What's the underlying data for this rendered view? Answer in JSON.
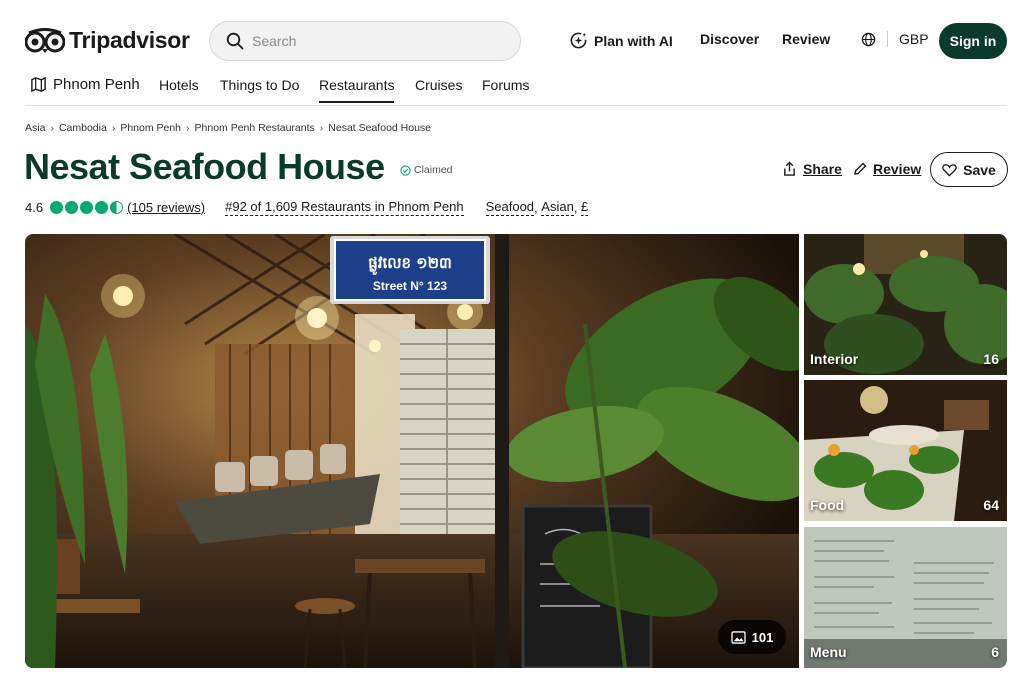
{
  "header": {
    "logo_text": "Tripadvisor",
    "search_placeholder": "Search",
    "plan_with_ai": "Plan with AI",
    "discover": "Discover",
    "review": "Review",
    "currency": "GBP",
    "sign_in": "Sign in"
  },
  "subnav": {
    "location": "Phnom Penh",
    "items": [
      "Hotels",
      "Things to Do",
      "Restaurants",
      "Cruises",
      "Forums"
    ],
    "active": "Restaurants"
  },
  "breadcrumb": [
    "Asia",
    "Cambodia",
    "Phnom Penh",
    "Phnom Penh Restaurants",
    "Nesat Seafood House"
  ],
  "restaurant": {
    "name": "Nesat Seafood House",
    "claimed": "Claimed",
    "rating": "4.6",
    "rating_value": 4.5,
    "reviews": "(105 reviews)",
    "rank": "#92 of 1,609 Restaurants in Phnom Penh",
    "cuisines": [
      "Seafood",
      "Asian",
      "£"
    ]
  },
  "actions": {
    "share": "Share",
    "review": "Review",
    "save": "Save"
  },
  "photos": {
    "total": "101",
    "street_sign_top": "ផ្លូវលេខ ១២៣",
    "street_sign_bottom": "Street N° 123",
    "categories": [
      {
        "label": "Interior",
        "count": "16"
      },
      {
        "label": "Food",
        "count": "64"
      },
      {
        "label": "Menu",
        "count": "6"
      }
    ]
  },
  "colors": {
    "brand_dark": "#0a3a2c",
    "rating_green": "#00aa6c"
  }
}
